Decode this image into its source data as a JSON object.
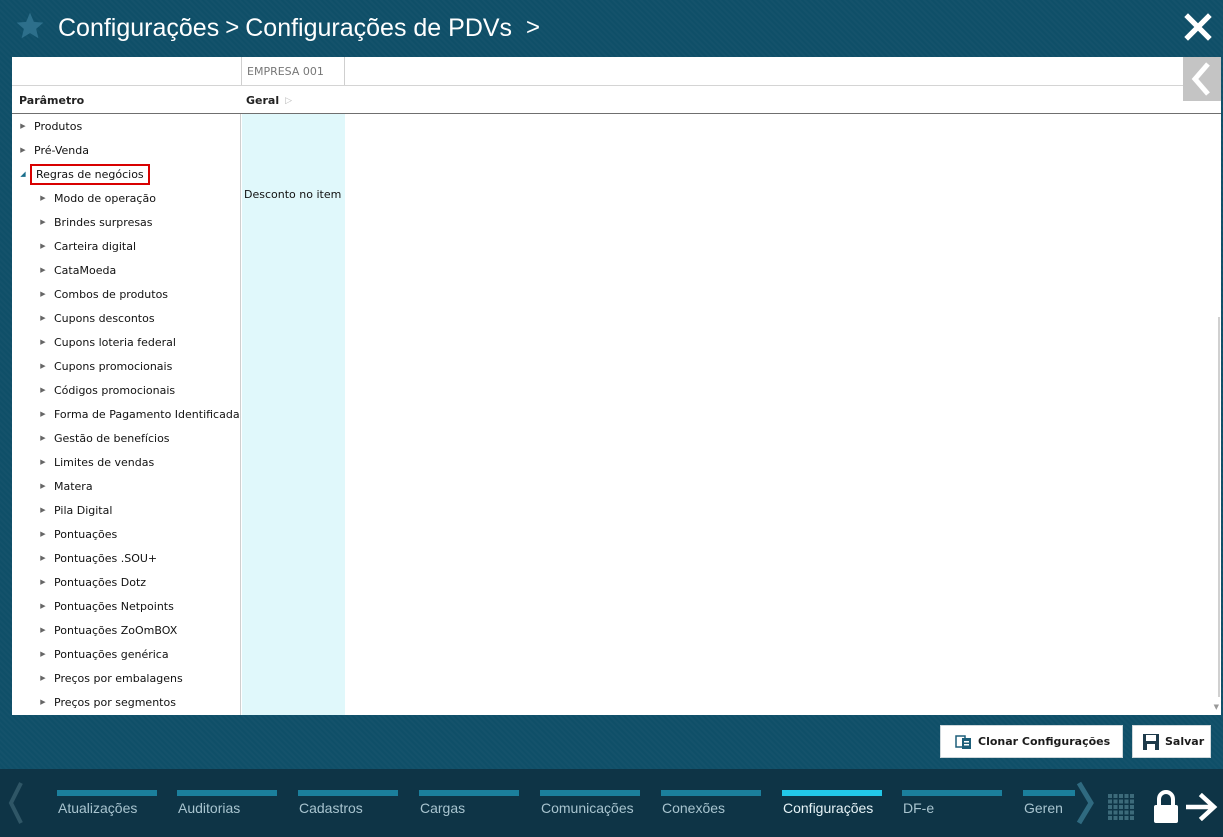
{
  "header": {
    "breadcrumb_1": "Configurações",
    "breadcrumb_2": "Configurações de PDVs"
  },
  "grid": {
    "company_header": "EMPRESA 001",
    "param_header": "Parâmetro",
    "geral_header": "Geral"
  },
  "tree": {
    "top": [
      "Produtos",
      "Pré-Venda",
      "Regras de negócios"
    ],
    "children": [
      "Modo de operação",
      "Brindes surpresas",
      "Carteira digital",
      "CataMoeda",
      "Combos de produtos",
      "Cupons descontos",
      "Cupons loteria federal",
      "Cupons promocionais",
      "Códigos promocionais",
      "Forma de Pagamento Identificada",
      "Gestão de benefícios",
      "Limites de vendas",
      "Matera",
      "Pila Digital",
      "Pontuações",
      "Pontuações .SOU+",
      "Pontuações Dotz",
      "Pontuações Netpoints",
      "Pontuações ZoOmBOX",
      "Pontuações genérica",
      "Preços por embalagens",
      "Preços por segmentos"
    ],
    "value_modo_operacao": "Desconto no item"
  },
  "actions": {
    "clone_label": "Clonar Configurações",
    "save_label": "Salvar"
  },
  "bottom_nav": {
    "items": [
      "Atualizações",
      "Auditorias",
      "Cadastros",
      "Cargas",
      "Comunicações",
      "Conexões",
      "Configurações",
      "DF-e",
      "Geren"
    ],
    "active": "Configurações"
  },
  "colors": {
    "background": "#0f4f68",
    "nav_background": "#0e3446",
    "active_bar": "#22c7e8",
    "bar": "#1b7f9c",
    "geral_column": "#e0f8fb",
    "highlight_outline": "#d80000"
  }
}
